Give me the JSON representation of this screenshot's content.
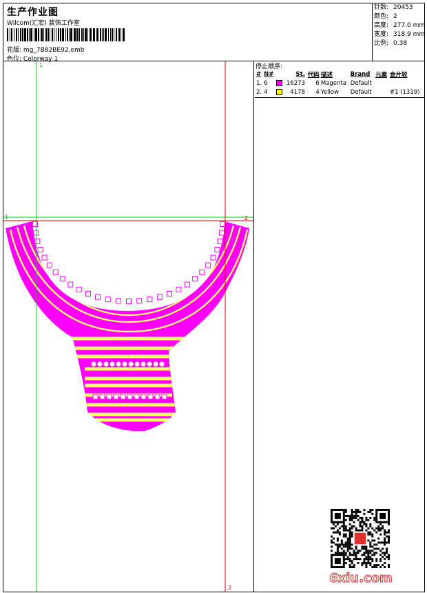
{
  "header": {
    "title": "生产作业图",
    "company": "Wilcom(汇宏) 装饰工作室",
    "design_label": "花版:",
    "design_file": "mg_7B82BE92.emb",
    "colorway_label": "色位:",
    "colorway": "Colorway 1"
  },
  "stats": [
    {
      "label": "针数:",
      "value": "20453"
    },
    {
      "label": "颜色:",
      "value": "2"
    },
    {
      "label": "高度:",
      "value": "277.0 mm"
    },
    {
      "label": "宽度:",
      "value": "318.9 mm"
    },
    {
      "label": "比例:",
      "value": "0.38"
    }
  ],
  "guides": {
    "green_vertical": "1",
    "green_horizontal": "1",
    "red_horizontal": "2",
    "red_vertical": "2"
  },
  "stop_sequence": {
    "title": "停止顺序:",
    "columns": [
      "#",
      "N#",
      "St.",
      "代码",
      "描述",
      "Brand",
      "元素",
      "金片较"
    ],
    "rows": [
      {
        "index": "1.",
        "needle": "6",
        "color": "#ff00ff",
        "stitches": "16273",
        "code": "6",
        "description": "Magenta",
        "brand": "Default",
        "element": "",
        "sequin": ""
      },
      {
        "index": "2.",
        "needle": "4",
        "color": "#ffff00",
        "stitches": "4178",
        "code": "4",
        "description": "Yellow",
        "brand": "Default",
        "element": "",
        "sequin": "#1 (1319)"
      }
    ]
  },
  "colors": {
    "magenta": "#ff00ff",
    "yellow": "#ffff66",
    "guide_green": "#00cc00",
    "guide_red": "#dd0000"
  },
  "watermark": "6xiu.com",
  "icons": [
    "barcode",
    "qr-code-icon",
    "seal-stamp-icon"
  ]
}
